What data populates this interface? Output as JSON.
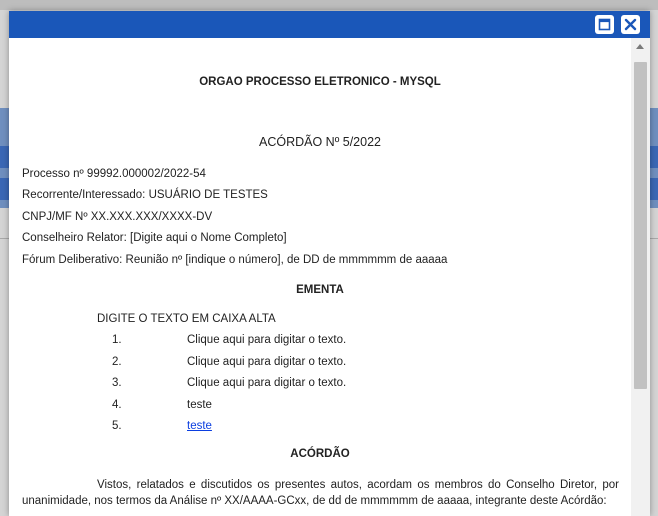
{
  "window": {
    "maximize_icon": "maximize-icon",
    "close_icon": "close-icon"
  },
  "document": {
    "heading": "ORGAO PROCESSO ELETRONICO - MYSQL",
    "acordao_title": "ACÓRDÃO Nº 5/2022",
    "fields": [
      "Processo nº 99992.000002/2022-54",
      "Recorrente/Interessado: USUÁRIO DE TESTES",
      "CNPJ/MF Nº XX.XXX.XXX/XXXX-DV",
      "Conselheiro Relator: [Digite aqui o Nome Completo]",
      "Fórum Deliberativo: Reunião nº [indique o número], de DD de mmmmmm de aaaaa"
    ],
    "ementa_heading": "EMENTA",
    "ementa_intro": "DIGITE O TEXTO EM CAIXA ALTA",
    "list": [
      {
        "num": "1.",
        "text": "Clique aqui para digitar o texto."
      },
      {
        "num": "2.",
        "text": "Clique aqui para digitar o texto."
      },
      {
        "num": "3.",
        "text": "Clique aqui para digitar o texto."
      },
      {
        "num": "4.",
        "text": "teste"
      },
      {
        "num": "5.",
        "text": "teste"
      }
    ],
    "acordao_heading": "ACÓRDÃO",
    "acordao_paragraph": "Vistos, relatados e discutidos os presentes autos, acordam os membros do Conselho Diretor, por unanimidade, nos termos da Análise nº XX/AAAA-GCxx, de dd de mmmmmm de aaaaa, integrante deste Acórdão:"
  },
  "colors": {
    "titlebar": "#1a57b9",
    "link": "#0b3ee0"
  }
}
